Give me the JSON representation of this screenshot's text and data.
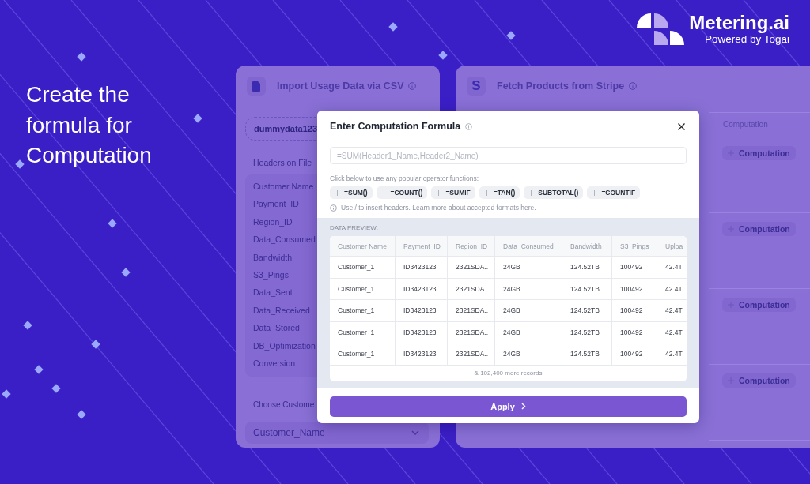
{
  "promo": {
    "headline": "Create the formula for Computation"
  },
  "brand": {
    "name": "Metering.ai",
    "tagline": "Powered by Togai"
  },
  "csv_card": {
    "title": "Import Usage Data via CSV",
    "file_name": "dummydata123",
    "headers_label": "Headers on File",
    "headers": [
      "Customer Name",
      "Payment_ID",
      "Region_ID",
      "Data_Consumed",
      "Bandwidth",
      "S3_Pings",
      "Data_Sent",
      "Data_Received",
      "Data_Stored",
      "DB_Optimization",
      "Conversion"
    ],
    "choose_label": "Choose Custome",
    "dropdown_value": "Customer_Name"
  },
  "stripe_card": {
    "icon_letter": "S",
    "title": "Fetch Products from Stripe",
    "column_header": "Computation",
    "rows": [
      {
        "button": "Computation"
      },
      {
        "button": "Computation"
      },
      {
        "button": "Computation"
      },
      {
        "button": "Computation"
      }
    ]
  },
  "modal": {
    "title": "Enter Computation Formula",
    "formula_placeholder": "=SUM(Header1_Name,Header2_Name)",
    "hint": "Click below to use any popular operator functions:",
    "operators": [
      "=SUM()",
      "=COUNT()",
      "=SUMIF",
      "=TAN()",
      "SUBTOTAL()",
      "=COUNTIF"
    ],
    "note": "Use / to insert headers. Learn more about accepted formats here.",
    "preview_label": "DATA PREVIEW:",
    "table": {
      "columns": [
        "Customer Name",
        "Payment_ID",
        "Region_ID",
        "Data_Consumed",
        "Bandwidth",
        "S3_Pings",
        "Uploa"
      ],
      "rows": [
        [
          "Customer_1",
          "ID3423123",
          "2321SDA..",
          "24GB",
          "124.52TB",
          "100492",
          "42.4T"
        ],
        [
          "Customer_1",
          "ID3423123",
          "2321SDA..",
          "24GB",
          "124.52TB",
          "100492",
          "42.4T"
        ],
        [
          "Customer_1",
          "ID3423123",
          "2321SDA..",
          "24GB",
          "124.52TB",
          "100492",
          "42.4T"
        ],
        [
          "Customer_1",
          "ID3423123",
          "2321SDA..",
          "24GB",
          "124.52TB",
          "100492",
          "42.4T"
        ],
        [
          "Customer_1",
          "ID3423123",
          "2321SDA..",
          "24GB",
          "124.52TB",
          "100492",
          "42.4T"
        ]
      ]
    },
    "more_records": "& 102,400 more records",
    "apply": "Apply"
  }
}
